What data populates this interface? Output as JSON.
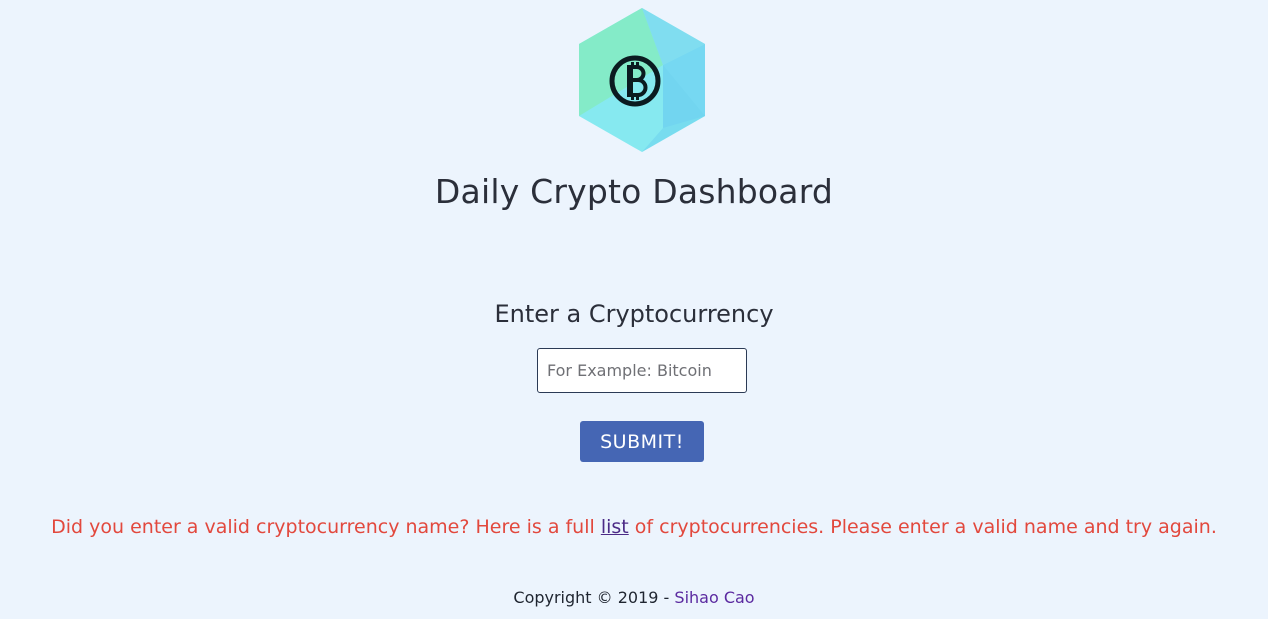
{
  "header": {
    "logo_icon": "bitcoin-hexagon-logo",
    "title": "Daily Crypto Dashboard"
  },
  "form": {
    "prompt": "Enter a Cryptocurrency",
    "input_value": "",
    "input_placeholder": "For Example: Bitcoin",
    "submit_label": "SUBMIT!"
  },
  "error": {
    "text_before": "Did you enter a valid cryptocurrency name? Here is a full ",
    "link_label": "list",
    "text_after": " of cryptocurrencies. Please enter a valid name and try again."
  },
  "footer": {
    "copyright": "Copyright © 2019 - ",
    "author": "Sihao Cao"
  },
  "colors": {
    "background": "#ecf4fd",
    "button": "#4566b4",
    "error": "#e2483d",
    "link": "#4b2a86",
    "author": "#5b2aa0"
  }
}
